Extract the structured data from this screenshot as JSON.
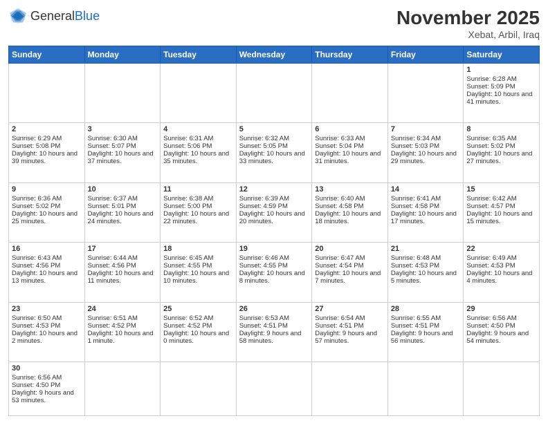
{
  "header": {
    "logo_general": "General",
    "logo_blue": "Blue",
    "month_title": "November 2025",
    "subtitle": "Xebat, Arbil, Iraq"
  },
  "days_of_week": [
    "Sunday",
    "Monday",
    "Tuesday",
    "Wednesday",
    "Thursday",
    "Friday",
    "Saturday"
  ],
  "weeks": [
    [
      {
        "day": "",
        "empty": true
      },
      {
        "day": "",
        "empty": true
      },
      {
        "day": "",
        "empty": true
      },
      {
        "day": "",
        "empty": true
      },
      {
        "day": "",
        "empty": true
      },
      {
        "day": "",
        "empty": true
      },
      {
        "day": "1",
        "sunrise": "6:28 AM",
        "sunset": "5:09 PM",
        "daylight": "10 hours and 41 minutes."
      }
    ],
    [
      {
        "day": "2",
        "sunrise": "6:29 AM",
        "sunset": "5:08 PM",
        "daylight": "10 hours and 39 minutes."
      },
      {
        "day": "3",
        "sunrise": "6:30 AM",
        "sunset": "5:07 PM",
        "daylight": "10 hours and 37 minutes."
      },
      {
        "day": "4",
        "sunrise": "6:31 AM",
        "sunset": "5:06 PM",
        "daylight": "10 hours and 35 minutes."
      },
      {
        "day": "5",
        "sunrise": "6:32 AM",
        "sunset": "5:05 PM",
        "daylight": "10 hours and 33 minutes."
      },
      {
        "day": "6",
        "sunrise": "6:33 AM",
        "sunset": "5:04 PM",
        "daylight": "10 hours and 31 minutes."
      },
      {
        "day": "7",
        "sunrise": "6:34 AM",
        "sunset": "5:03 PM",
        "daylight": "10 hours and 29 minutes."
      },
      {
        "day": "8",
        "sunrise": "6:35 AM",
        "sunset": "5:02 PM",
        "daylight": "10 hours and 27 minutes."
      }
    ],
    [
      {
        "day": "9",
        "sunrise": "6:36 AM",
        "sunset": "5:02 PM",
        "daylight": "10 hours and 25 minutes."
      },
      {
        "day": "10",
        "sunrise": "6:37 AM",
        "sunset": "5:01 PM",
        "daylight": "10 hours and 24 minutes."
      },
      {
        "day": "11",
        "sunrise": "6:38 AM",
        "sunset": "5:00 PM",
        "daylight": "10 hours and 22 minutes."
      },
      {
        "day": "12",
        "sunrise": "6:39 AM",
        "sunset": "4:59 PM",
        "daylight": "10 hours and 20 minutes."
      },
      {
        "day": "13",
        "sunrise": "6:40 AM",
        "sunset": "4:58 PM",
        "daylight": "10 hours and 18 minutes."
      },
      {
        "day": "14",
        "sunrise": "6:41 AM",
        "sunset": "4:58 PM",
        "daylight": "10 hours and 17 minutes."
      },
      {
        "day": "15",
        "sunrise": "6:42 AM",
        "sunset": "4:57 PM",
        "daylight": "10 hours and 15 minutes."
      }
    ],
    [
      {
        "day": "16",
        "sunrise": "6:43 AM",
        "sunset": "4:56 PM",
        "daylight": "10 hours and 13 minutes."
      },
      {
        "day": "17",
        "sunrise": "6:44 AM",
        "sunset": "4:56 PM",
        "daylight": "10 hours and 11 minutes."
      },
      {
        "day": "18",
        "sunrise": "6:45 AM",
        "sunset": "4:55 PM",
        "daylight": "10 hours and 10 minutes."
      },
      {
        "day": "19",
        "sunrise": "6:46 AM",
        "sunset": "4:55 PM",
        "daylight": "10 hours and 8 minutes."
      },
      {
        "day": "20",
        "sunrise": "6:47 AM",
        "sunset": "4:54 PM",
        "daylight": "10 hours and 7 minutes."
      },
      {
        "day": "21",
        "sunrise": "6:48 AM",
        "sunset": "4:53 PM",
        "daylight": "10 hours and 5 minutes."
      },
      {
        "day": "22",
        "sunrise": "6:49 AM",
        "sunset": "4:53 PM",
        "daylight": "10 hours and 4 minutes."
      }
    ],
    [
      {
        "day": "23",
        "sunrise": "6:50 AM",
        "sunset": "4:53 PM",
        "daylight": "10 hours and 2 minutes."
      },
      {
        "day": "24",
        "sunrise": "6:51 AM",
        "sunset": "4:52 PM",
        "daylight": "10 hours and 1 minute."
      },
      {
        "day": "25",
        "sunrise": "6:52 AM",
        "sunset": "4:52 PM",
        "daylight": "10 hours and 0 minutes."
      },
      {
        "day": "26",
        "sunrise": "6:53 AM",
        "sunset": "4:51 PM",
        "daylight": "9 hours and 58 minutes."
      },
      {
        "day": "27",
        "sunrise": "6:54 AM",
        "sunset": "4:51 PM",
        "daylight": "9 hours and 57 minutes."
      },
      {
        "day": "28",
        "sunrise": "6:55 AM",
        "sunset": "4:51 PM",
        "daylight": "9 hours and 56 minutes."
      },
      {
        "day": "29",
        "sunrise": "6:56 AM",
        "sunset": "4:50 PM",
        "daylight": "9 hours and 54 minutes."
      }
    ],
    [
      {
        "day": "30",
        "sunrise": "6:56 AM",
        "sunset": "4:50 PM",
        "daylight": "9 hours and 53 minutes."
      },
      {
        "day": "",
        "empty": true
      },
      {
        "day": "",
        "empty": true
      },
      {
        "day": "",
        "empty": true
      },
      {
        "day": "",
        "empty": true
      },
      {
        "day": "",
        "empty": true
      },
      {
        "day": "",
        "empty": true
      }
    ]
  ]
}
